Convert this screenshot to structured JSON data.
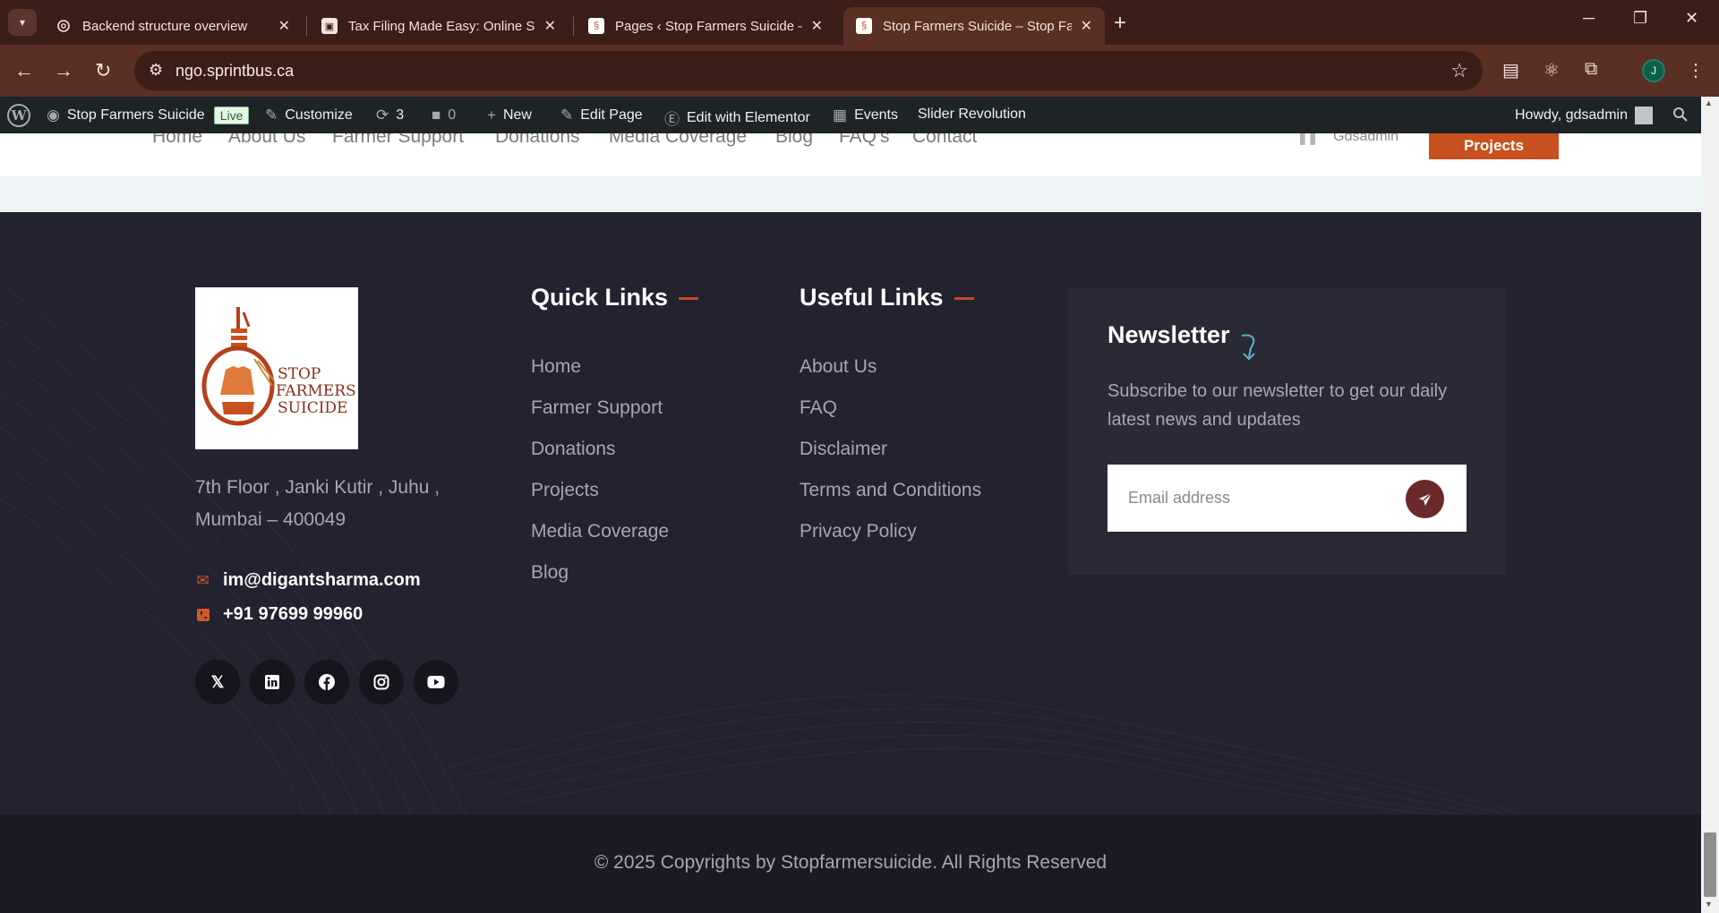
{
  "browser": {
    "tabs": [
      {
        "title": "Backend structure overview",
        "favicon": "openai-icon"
      },
      {
        "title": "Tax Filing Made Easy: Online Sol",
        "favicon": "page-icon"
      },
      {
        "title": "Pages ‹ Stop Farmers Suicide —",
        "favicon": "site-logo-icon"
      },
      {
        "title": "Stop Farmers Suicide – Stop Far",
        "favicon": "site-logo-icon",
        "active": true
      }
    ],
    "url": "ngo.sprintbus.ca",
    "profile_initial": "J"
  },
  "adminbar": {
    "site_name": "Stop Farmers Suicide",
    "live_badge": "Live",
    "customize": "Customize",
    "updates_count": "3",
    "comments_count": "0",
    "new": "New",
    "edit_page": "Edit Page",
    "edit_elementor": "Edit with Elementor",
    "events": "Events",
    "slider_revolution": "Slider Revolution",
    "howdy": "Howdy, gdsadmin"
  },
  "header": {
    "nav": [
      "Home",
      "About Us",
      "Farmer Support",
      "Donations",
      "Media Coverage",
      "Blog",
      "FAQ's",
      "Contact"
    ],
    "user": "Gdsadmin",
    "cta": "Projects"
  },
  "footer": {
    "logo_text": [
      "STOP",
      "FARMERS",
      "SUICIDE"
    ],
    "address": "7th Floor , Janki Kutir , Juhu , Mumbai – 400049",
    "email": "im@digantsharma.com",
    "phone": "+91 97699 99960",
    "social": [
      "x-icon",
      "linkedin-icon",
      "facebook-icon",
      "instagram-icon",
      "youtube-icon"
    ],
    "quick_links": {
      "title": "Quick Links",
      "items": [
        "Home",
        "Farmer Support",
        "Donations",
        "Projects",
        "Media Coverage",
        "Blog"
      ]
    },
    "useful_links": {
      "title": "Useful Links",
      "items": [
        "About Us",
        "FAQ",
        "Disclaimer",
        "Terms and Conditions",
        "Privacy Policy"
      ]
    },
    "newsletter": {
      "title": "Newsletter",
      "text": "Subscribe to our newsletter to get our daily latest news and updates",
      "placeholder": "Email address"
    },
    "copyright": "© 2025 Copyrights by Stopfarmersuicide. All Rights Reserved"
  },
  "colors": {
    "accent": "#c7511f",
    "footer_bg": "#222230",
    "admin_bar": "#1d2327"
  }
}
